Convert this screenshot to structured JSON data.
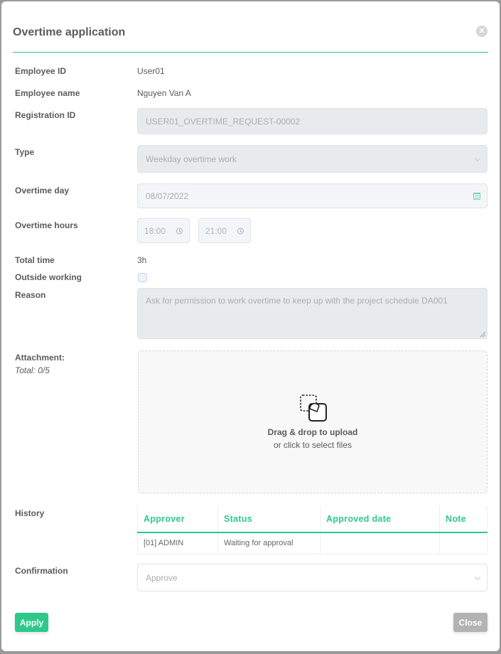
{
  "dialog": {
    "title": "Overtime application"
  },
  "fields": {
    "employee_id": {
      "label": "Employee ID",
      "value": "User01"
    },
    "employee_name": {
      "label": "Employee name",
      "value": "Nguyen Van A"
    },
    "registration_id": {
      "label": "Registration ID",
      "value": "USER01_OVERTIME_REQUEST-00002"
    },
    "type": {
      "label": "Type",
      "value": "Weekday overtime work"
    },
    "overtime_day": {
      "label": "Overtime day",
      "value": "08/07/2022"
    },
    "overtime_hours": {
      "label": "Overtime hours",
      "start": "18:00",
      "end": "21:00"
    },
    "total_time": {
      "label": "Total time",
      "value": "3h"
    },
    "outside_working": {
      "label": "Outside working",
      "checked": false
    },
    "reason": {
      "label": "Reason",
      "value": "Ask for permission to work overtime to keep up with the project schedule DA001"
    },
    "attachment": {
      "label": "Attachment:",
      "total": "Total: 0/5",
      "dropzone_title": "Drag & drop to upload",
      "dropzone_subtitle": "or click to select files"
    },
    "history": {
      "label": "History",
      "columns": [
        "Approver",
        "Status",
        "Approved date",
        "Note"
      ],
      "rows": [
        [
          "[01] ADMIN",
          "Waiting for approval",
          "",
          ""
        ]
      ]
    },
    "confirmation": {
      "label": "Confirmation",
      "placeholder": "Approve"
    }
  },
  "buttons": {
    "apply": "Apply",
    "close": "Close"
  },
  "colors": {
    "accent": "#2ec98a",
    "close_button": "#b3b3b3"
  },
  "icons": {
    "close": "close-circle-icon",
    "type_dropdown": "chevron-down-icon",
    "date": "calendar-icon",
    "time": "clock-icon",
    "upload": "drag-drop-icon"
  }
}
